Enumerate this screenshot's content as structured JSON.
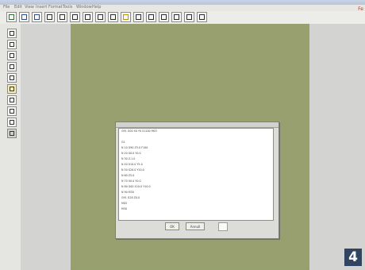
{
  "window": {
    "title": "",
    "menu_items": [
      "File",
      "Edit",
      "View",
      "Insert",
      "Format",
      "Tools",
      "Window",
      "Help"
    ],
    "right_label": "Fe"
  },
  "toolbar": {
    "icons": [
      "new-icon",
      "open-icon",
      "save-icon",
      "print-icon",
      "cut-icon",
      "copy-icon",
      "paste-icon",
      "undo-icon",
      "redo-icon",
      "zoom-icon",
      "line-icon",
      "grid-icon",
      "curve-icon",
      "layer-icon",
      "text-icon",
      "check-icon"
    ]
  },
  "side_tools": {
    "icons": [
      "pointer-icon",
      "hand-icon",
      "pencil-icon",
      "brush-icon",
      "node-icon",
      "yellow-tool-icon",
      "select-icon",
      "erase-icon",
      "measure-icon",
      "gray-tool-icon"
    ]
  },
  "dialog": {
    "title": "",
    "lines": [
      "G91 G00 X0 Y0 S1200 M03",
      "",
      "G1",
      "N 10 G90 Z5.0 F100",
      "N 20 X0.0 Y0.0",
      "N 30 Z-1.0",
      "N 40 X10.0 Y5.0",
      "N 50 X20.0 Y10.0",
      "N 60 Z5.0",
      "N 70 X0.0 Y0.0",
      "N 80 G00 X10.0 Y10.0",
      "N 90 M30",
      "G91 G28 Z0.0",
      "M05",
      "M30"
    ],
    "ok_label": "OK",
    "cancel_label": "Annull",
    "status": "",
    "option_a": "",
    "option_b": ""
  },
  "badge": {
    "value": "4"
  }
}
